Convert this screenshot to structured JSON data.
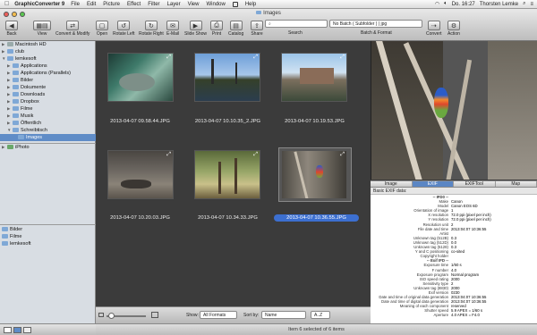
{
  "menubar": {
    "apple": "",
    "app": "GraphicConverter 9",
    "items": [
      "File",
      "Edit",
      "Picture",
      "Effect",
      "Filter",
      "Layer",
      "View",
      "Window",
      "",
      "Help"
    ],
    "clock": "Do. 16:27",
    "user": "Thorsten Lemke"
  },
  "window": {
    "title": "Images"
  },
  "toolbar": {
    "back": "Back",
    "view": "View",
    "convert": "Convert & Modify",
    "open": "Open",
    "rotate_left": "Rotate Left",
    "rotate_right": "Rotate Right",
    "email": "E-Mail",
    "slideshow": "Slide Show",
    "print": "Print",
    "catalog": "Catalog",
    "share": "Share",
    "search": "Search",
    "batch": "Batch & Format",
    "convert2": "Convert",
    "action": "Action",
    "batch_value": "No Batch ( Subfolder ) | jpg"
  },
  "sidebar": {
    "items": [
      {
        "label": "Macintosh HD",
        "indent": 0,
        "tri": "▶"
      },
      {
        "label": "club",
        "indent": 0,
        "tri": "▶"
      },
      {
        "label": "lemkesoft",
        "indent": 0,
        "tri": "▼"
      },
      {
        "label": "Applications",
        "indent": 1,
        "tri": "▶"
      },
      {
        "label": "Applications (Parallels)",
        "indent": 1,
        "tri": "▶"
      },
      {
        "label": "Bilder",
        "indent": 1,
        "tri": "▶"
      },
      {
        "label": "Dokumente",
        "indent": 1,
        "tri": "▶"
      },
      {
        "label": "Downloads",
        "indent": 1,
        "tri": "▶"
      },
      {
        "label": "Dropbox",
        "indent": 1,
        "tri": "▶"
      },
      {
        "label": "Filme",
        "indent": 1,
        "tri": "▶"
      },
      {
        "label": "Musik",
        "indent": 1,
        "tri": "▶"
      },
      {
        "label": "Öffentlich",
        "indent": 1,
        "tri": "▶"
      },
      {
        "label": "Schreibtisch",
        "indent": 1,
        "tri": "▼"
      },
      {
        "label": "Images",
        "indent": 2,
        "tri": ""
      }
    ],
    "iphoto": "iPhoto",
    "favorites": [
      "Bilder",
      "Filme",
      "lemkesoft"
    ]
  },
  "thumbnails": [
    {
      "name": "2013-04-07 09.58.44.JPG",
      "selected": false
    },
    {
      "name": "2013-04-07 10.10.35_2.JPG",
      "selected": false
    },
    {
      "name": "2013-04-07 10.19.53.JPG",
      "selected": false
    },
    {
      "name": "2013-04-07 10.20.03.JPG",
      "selected": false
    },
    {
      "name": "2013-04-07 10.34.33.JPG",
      "selected": false
    },
    {
      "name": "2013-04-07 10.36.55.JPG",
      "selected": true
    }
  ],
  "browser_bottom": {
    "show_label": "Show:",
    "show_value": "All Formats",
    "sort_label": "Sort by:",
    "sort_value": "Name",
    "order_value": "A..Z"
  },
  "status": "Item 6 selected of 6 items",
  "tabs": [
    "Image",
    "EXIF",
    "EXIFTool",
    "Map"
  ],
  "active_tab": "EXIF",
  "info_head": "Basic EXIF data:",
  "info_rows": [
    {
      "k": "-- IFD0 --",
      "v": "",
      "sec": true
    },
    {
      "k": "Make",
      "v": "Canon"
    },
    {
      "k": "Model",
      "v": "Canon EOS 6D"
    },
    {
      "k": "Orientation of image",
      "v": "1"
    },
    {
      "k": "X resolution",
      "v": "72.0 ppi (pixel per inch)"
    },
    {
      "k": "Y resolution",
      "v": "72.0 ppi (pixel per inch)"
    },
    {
      "k": "Resolution unit",
      "v": "2"
    },
    {
      "k": "File date and time",
      "v": "2013:04:07 10:36:55"
    },
    {
      "k": "Artist",
      "v": ""
    },
    {
      "k": "Unknown tag (512B)",
      "v": "0.3"
    },
    {
      "k": "Unknown tag (512D)",
      "v": "0.0"
    },
    {
      "k": "Unknown tag (5128)",
      "v": "0.3"
    },
    {
      "k": "Y and C positioning",
      "v": "co-sited"
    },
    {
      "k": "Copyright holder",
      "v": ""
    },
    {
      "k": "-- Exif IFD --",
      "v": "",
      "sec": true
    },
    {
      "k": "Exposure time",
      "v": "1/60 s"
    },
    {
      "k": "F number",
      "v": "4.0"
    },
    {
      "k": "Exposure program",
      "v": "Normal program"
    },
    {
      "k": "ISO speed rating",
      "v": "2000"
    },
    {
      "k": "Sensitivity type",
      "v": "2"
    },
    {
      "k": "Unknown tag (8830)",
      "v": "2000"
    },
    {
      "k": "Exif version",
      "v": "0230"
    },
    {
      "k": "Date and time of original data generation",
      "v": "2013:04:07 10:36:55"
    },
    {
      "k": "Date and time of digital data generation",
      "v": "2013:04:07 10:36:55"
    },
    {
      "k": "Meaning of each component",
      "v": "reserved"
    },
    {
      "k": "Shutter speed",
      "v": "5.9 APEX = 1/60 s"
    },
    {
      "k": "Aperture",
      "v": "4.0 APEX = F4.0"
    }
  ]
}
